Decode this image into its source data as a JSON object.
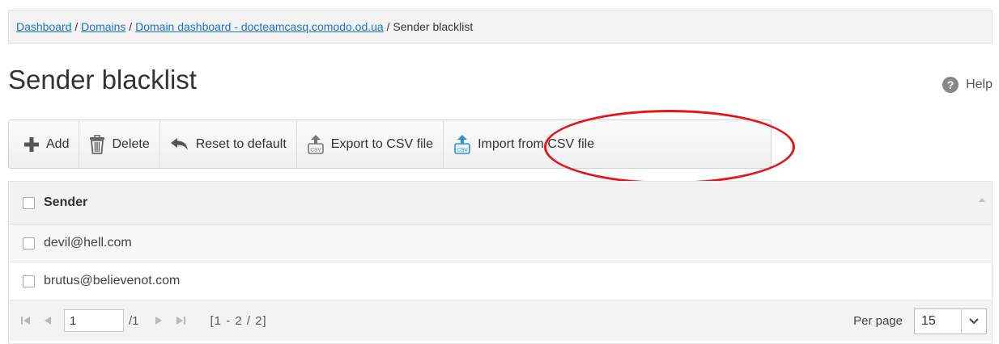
{
  "breadcrumb": {
    "items": [
      {
        "label": "Dashboard",
        "link": true
      },
      {
        "label": "Domains",
        "link": true
      },
      {
        "label": "Domain dashboard - docteamcasq.comodo.od.ua",
        "link": true
      },
      {
        "label": "Sender blacklist",
        "link": false
      }
    ],
    "separator": " / "
  },
  "page": {
    "title": "Sender blacklist",
    "help_label": "Help",
    "help_icon_glyph": "?"
  },
  "toolbar": {
    "add_label": "Add",
    "delete_label": "Delete",
    "reset_label": "Reset to default",
    "export_label": "Export to CSV file",
    "import_label": "Import from CSV file"
  },
  "grid": {
    "column_header": "Sender",
    "rows": [
      "devil@hell.com",
      "brutus@believenot.com"
    ]
  },
  "pager": {
    "current_page": "1",
    "total_pages": "/1",
    "range": "[1 - 2 / 2]",
    "per_page_label": "Per page",
    "per_page_value": "15"
  },
  "colors": {
    "link": "#1a73c9",
    "annotation": "#e8141a",
    "csv_icon_blue": "#2e8fd8"
  }
}
